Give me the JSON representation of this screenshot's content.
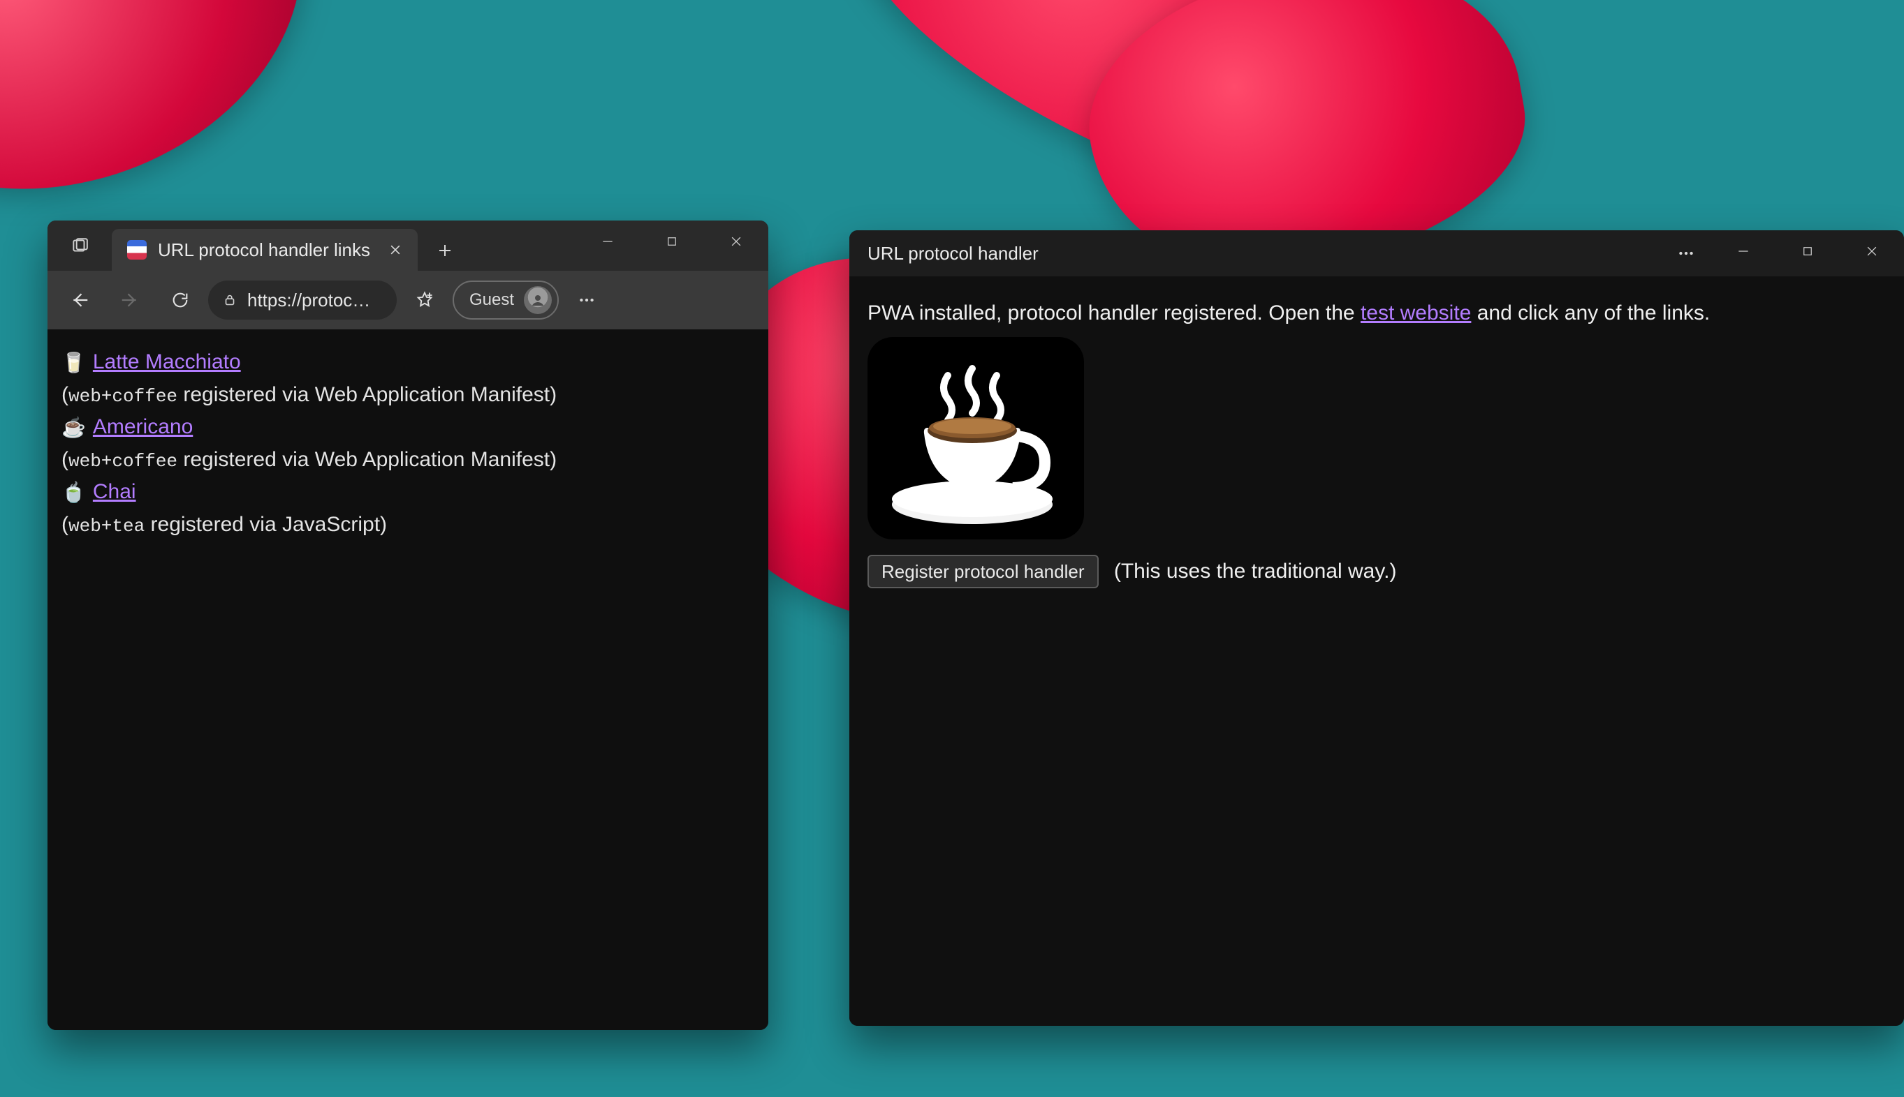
{
  "browser": {
    "tab_title": "URL protocol handler links",
    "address": "https://protoc…",
    "profile_label": "Guest",
    "links": [
      {
        "emoji": "🥛",
        "text": "  Latte Macchiato",
        "visited": true,
        "proto": "web+coffee",
        "regvia": " registered via Web Application Manifest)"
      },
      {
        "emoji": "☕",
        "text": "  Americano",
        "visited": true,
        "proto": "web+coffee",
        "regvia": " registered via Web Application Manifest)"
      },
      {
        "emoji": "🍵",
        "text": "  Chai",
        "visited": true,
        "proto": "web+tea",
        "regvia": " registered via JavaScript)"
      }
    ]
  },
  "pwa": {
    "title": "URL protocol handler",
    "status_prefix": "PWA installed, protocol handler registered. Open the ",
    "status_link": "test website",
    "status_suffix": " and click any of the links.",
    "button_label": "Register protocol handler",
    "button_note": "(This uses the traditional way.)"
  }
}
